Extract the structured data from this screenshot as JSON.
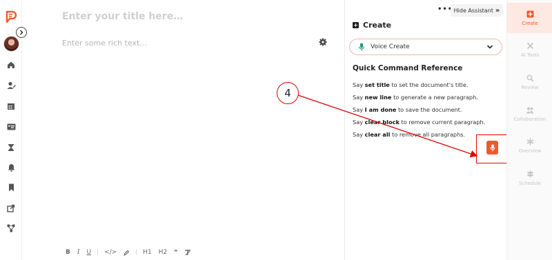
{
  "editor": {
    "title_placeholder": "Enter your title here…",
    "body_placeholder": "Enter some rich text…",
    "toolbar": {
      "bold": "B",
      "italic": "I",
      "underline": "U",
      "code": "</>",
      "sep": "|",
      "h1": "H1",
      "h2": "H2",
      "quote": "❝",
      "clear": "T̶"
    }
  },
  "assistant": {
    "more": "•••",
    "hide_label": "Hide Assistant",
    "hide_chevron": "»",
    "create_title": "Create",
    "voice_select_value": "Voice Create",
    "qcr_title": "Quick Command Reference",
    "commands": [
      {
        "pre": "Say ",
        "keyword": "set title",
        "post": " to set the document's title."
      },
      {
        "pre": "Say ",
        "keyword": "new line",
        "post": " to generate a new paragraph."
      },
      {
        "pre": "Say ",
        "keyword": "I am done",
        "post": " to save the document."
      },
      {
        "pre": "Say ",
        "keyword": "clear block",
        "post": " to remove current paragraph."
      },
      {
        "pre": "Say ",
        "keyword": "clear all",
        "post": " to remove all paragraphs."
      }
    ]
  },
  "rail": {
    "items": [
      {
        "label": "Create",
        "icon": "plus-square-icon",
        "active": true
      },
      {
        "label": "AI Tools",
        "icon": "tools-icon",
        "active": false
      },
      {
        "label": "Review",
        "icon": "search-icon",
        "active": false
      },
      {
        "label": "Collaboration",
        "icon": "users-icon",
        "active": false
      },
      {
        "label": "Overview",
        "icon": "asterisk-icon",
        "active": false
      },
      {
        "label": "Schedule",
        "icon": "signpost-icon",
        "active": false
      }
    ]
  },
  "annotation": {
    "step_number": "4"
  },
  "colors": {
    "brand": "#f05a28",
    "annotation": "#e00000"
  }
}
